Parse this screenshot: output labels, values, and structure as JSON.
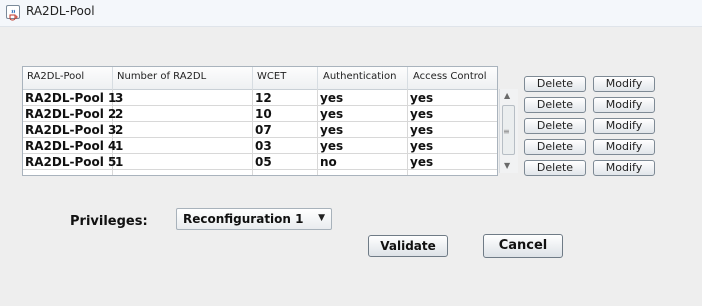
{
  "window": {
    "title": "RA2DL-Pool",
    "icon": "java-cup-icon"
  },
  "table": {
    "columns": [
      "RA2DL-Pool",
      "Number of RA2DL",
      "WCET",
      "Authentication",
      "Access Control"
    ],
    "rows": [
      [
        "RA2DL-Pool 1",
        "3",
        "12",
        "yes",
        "yes"
      ],
      [
        "RA2DL-Pool 2",
        "2",
        "10",
        "yes",
        "yes"
      ],
      [
        "RA2DL-Pool 3",
        "2",
        "07",
        "yes",
        "yes"
      ],
      [
        "RA2DL-Pool 4",
        "1",
        "03",
        "yes",
        "yes"
      ],
      [
        "RA2DL-Pool 5",
        "1",
        "05",
        "no",
        "yes"
      ]
    ]
  },
  "row_actions": {
    "delete_label": "Delete",
    "modify_label": "Modify"
  },
  "privileges": {
    "label": "Privileges:",
    "selected": "Reconfiguration 1"
  },
  "buttons": {
    "validate": "Validate",
    "cancel": "Cancel"
  }
}
